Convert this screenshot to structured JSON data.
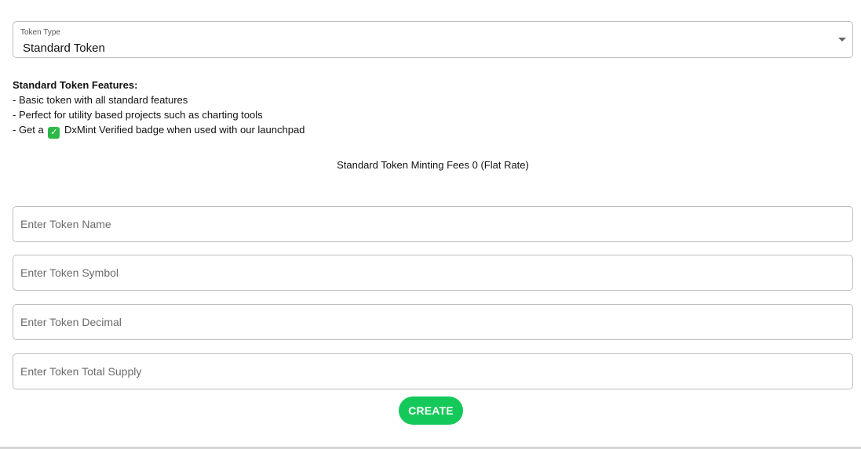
{
  "token_type": {
    "label": "Token Type",
    "selected": "Standard Token"
  },
  "features": {
    "title": "Standard Token Features:",
    "line1": "- Basic token with all standard features",
    "line2": "- Perfect for utility based projects such as charting tools",
    "line3_prefix": "- Get a",
    "line3_suffix": "DxMint Verified badge when used with our launchpad",
    "badge_icon": "check-mark-icon",
    "badge_color": "#2fb84a"
  },
  "fees_text": "Standard Token Minting Fees 0 (Flat Rate)",
  "form": {
    "name_placeholder": "Enter Token Name",
    "symbol_placeholder": "Enter Token Symbol",
    "decimal_placeholder": "Enter Token Decimal",
    "supply_placeholder": "Enter Token Total Supply"
  },
  "create_label": "CREATE",
  "accent_color": "#14c95a"
}
